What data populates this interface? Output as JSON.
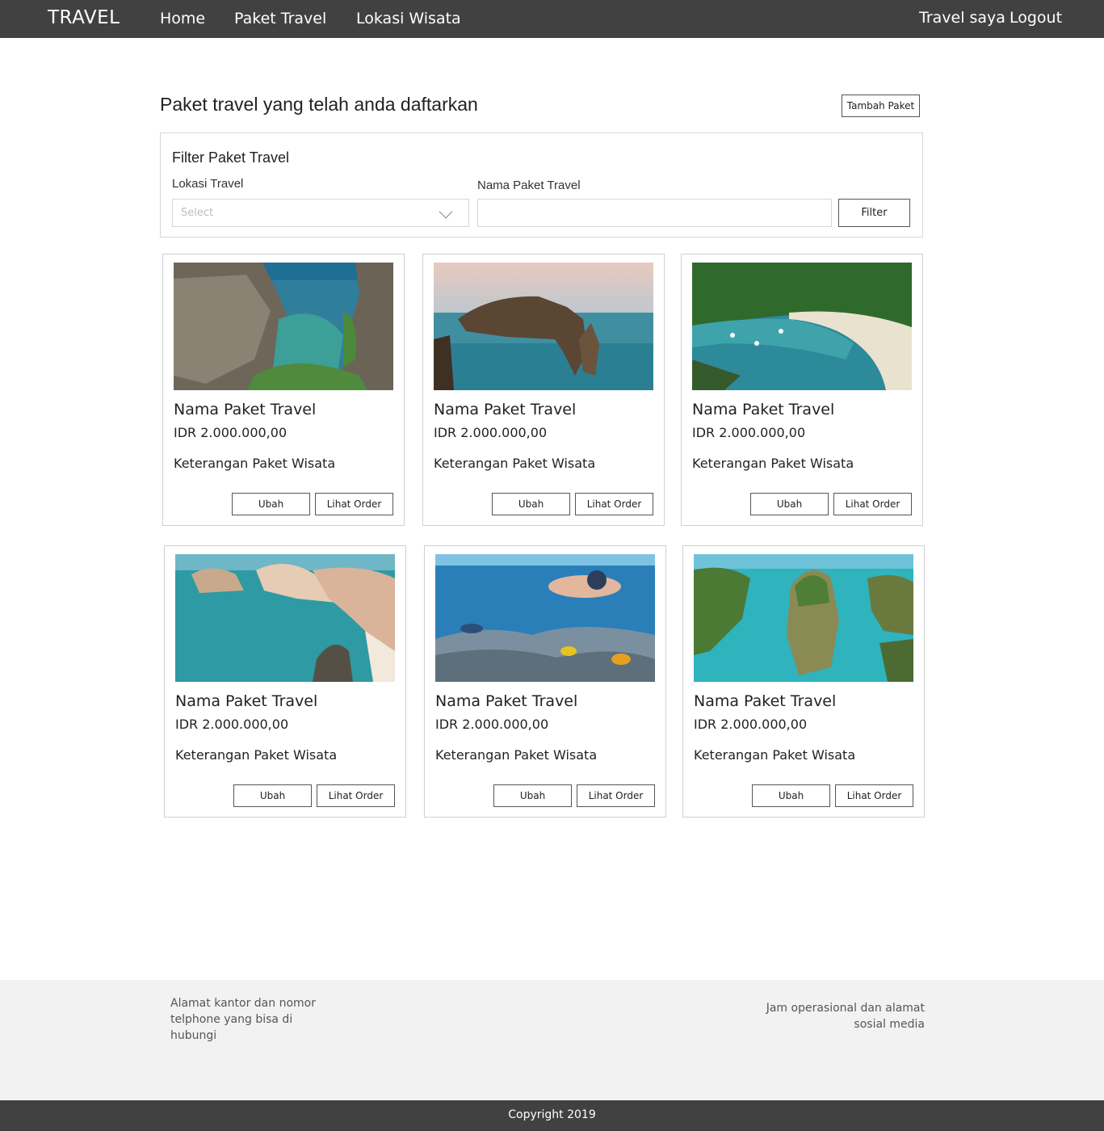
{
  "navbar": {
    "brand": "TRAVEL",
    "links": [
      "Home",
      "Paket Travel",
      "Lokasi Wisata"
    ],
    "travel_saya": "Travel saya",
    "logout": "Logout"
  },
  "header": {
    "title": "Paket travel yang telah anda daftarkan",
    "add_button": "Tambah Paket"
  },
  "filter": {
    "title": "Filter Paket Travel",
    "location_label": "Lokasi Travel",
    "location_placeholder": "Select",
    "name_label": "Nama Paket Travel",
    "name_value": "",
    "button": "Filter"
  },
  "cards": [
    {
      "name": "Nama Paket Travel",
      "price": "IDR 2.000.000,00",
      "desc": "Keterangan Paket Wisata",
      "edit": "Ubah",
      "orders": "Lihat Order",
      "image": "rock-pool-icon"
    },
    {
      "name": "Nama Paket Travel",
      "price": "IDR 2.000.000,00",
      "desc": "Keterangan Paket Wisata",
      "edit": "Ubah",
      "orders": "Lihat Order",
      "image": "sea-cliff-icon"
    },
    {
      "name": "Nama Paket Travel",
      "price": "IDR 2.000.000,00",
      "desc": "Keterangan Paket Wisata",
      "edit": "Ubah",
      "orders": "Lihat Order",
      "image": "bay-beach-icon"
    },
    {
      "name": "Nama Paket Travel",
      "price": "IDR 2.000.000,00",
      "desc": "Keterangan Paket Wisata",
      "edit": "Ubah",
      "orders": "Lihat Order",
      "image": "coast-rocks-icon"
    },
    {
      "name": "Nama Paket Travel",
      "price": "IDR 2.000.000,00",
      "desc": "Keterangan Paket Wisata",
      "edit": "Ubah",
      "orders": "Lihat Order",
      "image": "snorkeling-icon"
    },
    {
      "name": "Nama Paket Travel",
      "price": "IDR 2.000.000,00",
      "desc": "Keterangan Paket Wisata",
      "edit": "Ubah",
      "orders": "Lihat Order",
      "image": "dinosaur-cliff-icon"
    }
  ],
  "footer": {
    "left": "Alamat kantor dan nomor telphone yang bisa di hubungi",
    "right": "Jam operasional dan alamat sosial media",
    "copyright": "Copyright 2019"
  },
  "colors": {
    "nav_bg": "#414141",
    "footer_bg": "#f2f2f2",
    "border": "#d0d0d0"
  }
}
